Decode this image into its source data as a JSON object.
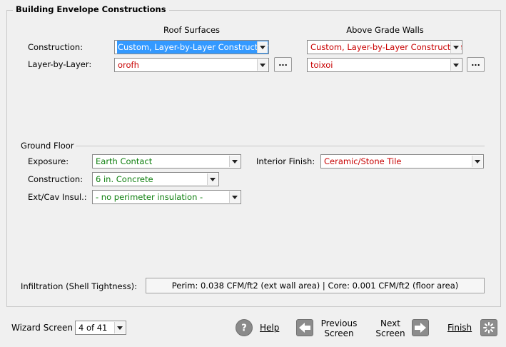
{
  "group": {
    "title": "Building Envelope Constructions"
  },
  "columns": {
    "roof": "Roof Surfaces",
    "walls": "Above Grade Walls"
  },
  "rows": {
    "construction_label": "Construction:",
    "layer_label": "Layer-by-Layer:"
  },
  "roof": {
    "construction_value": "Custom, Layer-by-Layer Construction",
    "layer_value": "orofh",
    "browse_label": "..."
  },
  "walls": {
    "construction_value": "Custom, Layer-by-Layer Construction",
    "layer_value": "toixoi",
    "browse_label": "..."
  },
  "ground_floor": {
    "title": "Ground Floor",
    "exposure_label": "Exposure:",
    "exposure_value": "Earth Contact",
    "interior_finish_label": "Interior Finish:",
    "interior_finish_value": "Ceramic/Stone Tile",
    "construction_label": "Construction:",
    "construction_value": "6 in. Concrete",
    "insul_label": "Ext/Cav Insul.:",
    "insul_value": "- no perimeter insulation -"
  },
  "infiltration": {
    "label": "Infiltration (Shell Tightness):",
    "value": "Perim: 0.038 CFM/ft2 (ext wall area)   |   Core: 0.001 CFM/ft2 (floor area)"
  },
  "footer": {
    "wizard_label": "Wizard Screen",
    "wizard_value": "4 of 41",
    "help_label": "Help",
    "previous_line1": "Previous",
    "previous_line2": "Screen",
    "next_line1": "Next",
    "next_line2": "Screen",
    "finish_label": "Finish"
  },
  "colors": {
    "red_text": "#c80000",
    "green_text": "#108010",
    "selection": "#3399ff"
  }
}
